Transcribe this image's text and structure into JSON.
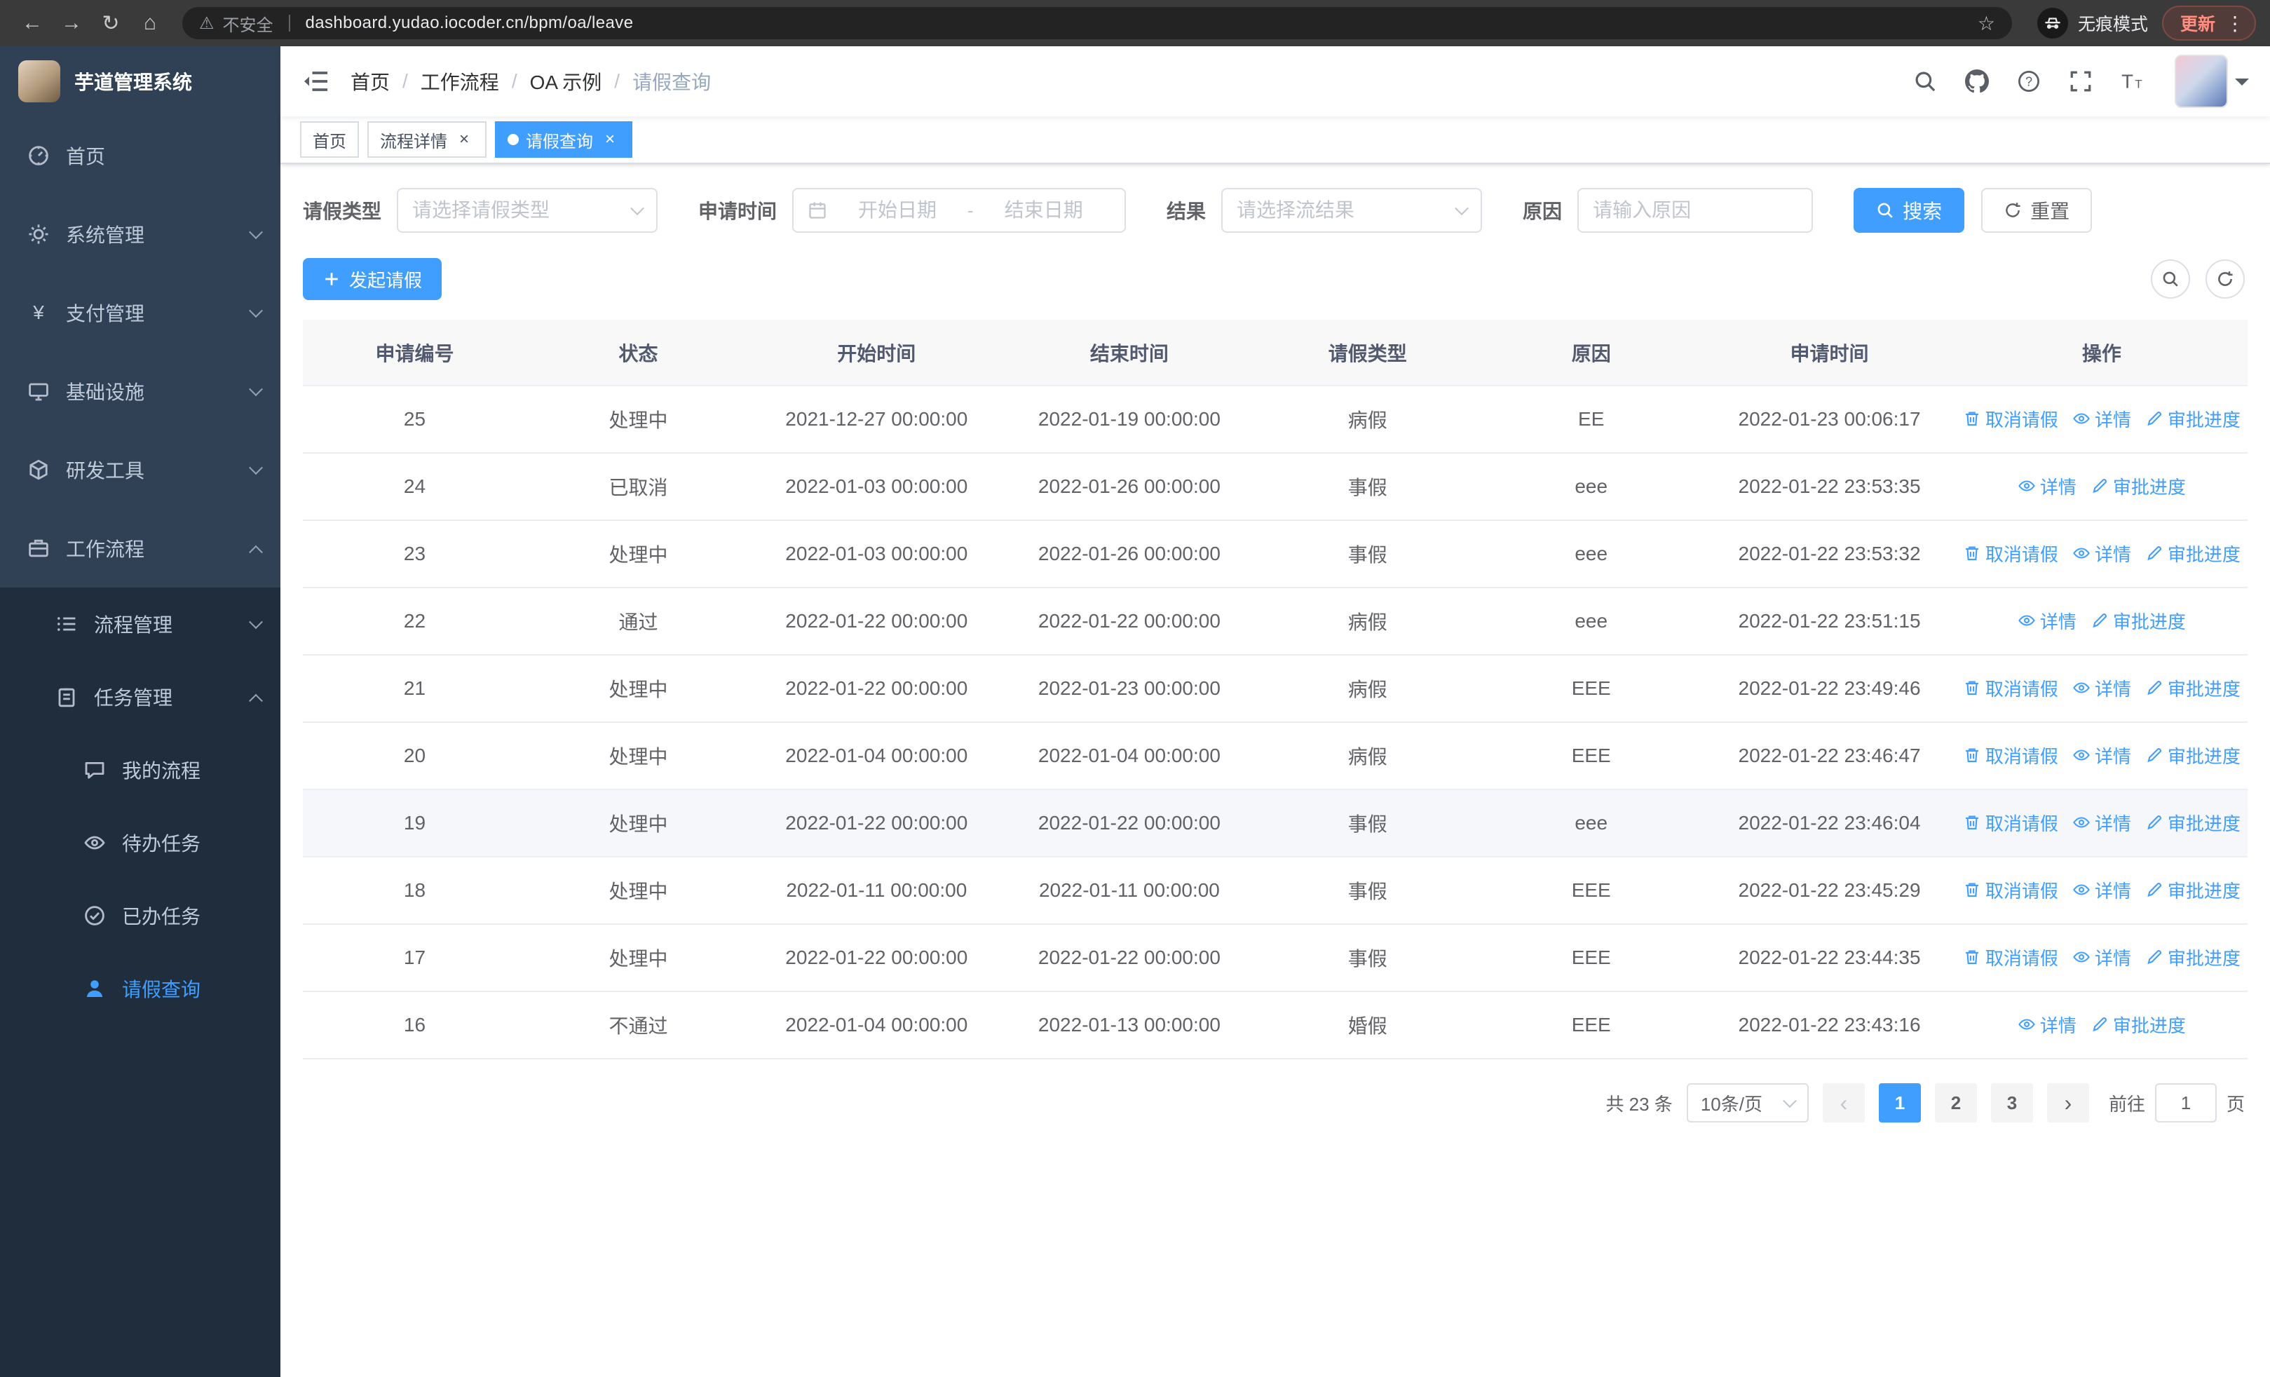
{
  "browser": {
    "security_label": "不安全",
    "url": "dashboard.yudao.iocoder.cn/bpm/oa/leave",
    "incognito_label": "无痕模式",
    "update_label": "更新"
  },
  "icons": {
    "back": "←",
    "forward": "→",
    "reload": "↻",
    "home": "⌂",
    "warning": "⚠",
    "star": "☆",
    "kebab": "⋮",
    "close": "×",
    "prev": "‹",
    "next": "›"
  },
  "app_title": "芋道管理系统",
  "sidebar": {
    "items": [
      {
        "label": "首页"
      },
      {
        "label": "系统管理"
      },
      {
        "label": "支付管理"
      },
      {
        "label": "基础设施"
      },
      {
        "label": "研发工具"
      },
      {
        "label": "工作流程"
      }
    ],
    "workflow_children": [
      {
        "label": "流程管理"
      },
      {
        "label": "任务管理"
      }
    ],
    "task_children": [
      {
        "label": "我的流程"
      },
      {
        "label": "待办任务"
      },
      {
        "label": "已办任务"
      },
      {
        "label": "请假查询"
      }
    ]
  },
  "breadcrumb": {
    "separator": "/",
    "items": [
      "首页",
      "工作流程",
      "OA 示例",
      "请假查询"
    ]
  },
  "tags": [
    {
      "label": "首页"
    },
    {
      "label": "流程详情"
    },
    {
      "label": "请假查询"
    }
  ],
  "filters": {
    "leave_type_label": "请假类型",
    "leave_type_placeholder": "请选择请假类型",
    "apply_time_label": "申请时间",
    "start_placeholder": "开始日期",
    "range_separator": "-",
    "end_placeholder": "结束日期",
    "result_label": "结果",
    "result_placeholder": "请选择流结果",
    "reason_label": "原因",
    "reason_placeholder": "请输入原因",
    "search_label": "搜索",
    "reset_label": "重置"
  },
  "toolbar": {
    "create_label": "发起请假"
  },
  "table": {
    "headers": [
      "申请编号",
      "状态",
      "开始时间",
      "结束时间",
      "请假类型",
      "原因",
      "申请时间",
      "操作"
    ],
    "action_labels": {
      "cancel": "取消请假",
      "detail": "详情",
      "progress": "审批进度"
    },
    "rows": [
      {
        "id": "25",
        "status": "处理中",
        "start_time": "2021-12-27 00:00:00",
        "end_time": "2022-01-19 00:00:00",
        "leave_type": "病假",
        "reason": "EE",
        "apply_time": "2022-01-23 00:06:17",
        "cancellable": true,
        "highlighted": false
      },
      {
        "id": "24",
        "status": "已取消",
        "start_time": "2022-01-03 00:00:00",
        "end_time": "2022-01-26 00:00:00",
        "leave_type": "事假",
        "reason": "eee",
        "apply_time": "2022-01-22 23:53:35",
        "cancellable": false,
        "highlighted": false
      },
      {
        "id": "23",
        "status": "处理中",
        "start_time": "2022-01-03 00:00:00",
        "end_time": "2022-01-26 00:00:00",
        "leave_type": "事假",
        "reason": "eee",
        "apply_time": "2022-01-22 23:53:32",
        "cancellable": true,
        "highlighted": false
      },
      {
        "id": "22",
        "status": "通过",
        "start_time": "2022-01-22 00:00:00",
        "end_time": "2022-01-22 00:00:00",
        "leave_type": "病假",
        "reason": "eee",
        "apply_time": "2022-01-22 23:51:15",
        "cancellable": false,
        "highlighted": false
      },
      {
        "id": "21",
        "status": "处理中",
        "start_time": "2022-01-22 00:00:00",
        "end_time": "2022-01-23 00:00:00",
        "leave_type": "病假",
        "reason": "EEE",
        "apply_time": "2022-01-22 23:49:46",
        "cancellable": true,
        "highlighted": false
      },
      {
        "id": "20",
        "status": "处理中",
        "start_time": "2022-01-04 00:00:00",
        "end_time": "2022-01-04 00:00:00",
        "leave_type": "病假",
        "reason": "EEE",
        "apply_time": "2022-01-22 23:46:47",
        "cancellable": true,
        "highlighted": false
      },
      {
        "id": "19",
        "status": "处理中",
        "start_time": "2022-01-22 00:00:00",
        "end_time": "2022-01-22 00:00:00",
        "leave_type": "事假",
        "reason": "eee",
        "apply_time": "2022-01-22 23:46:04",
        "cancellable": true,
        "highlighted": true
      },
      {
        "id": "18",
        "status": "处理中",
        "start_time": "2022-01-11 00:00:00",
        "end_time": "2022-01-11 00:00:00",
        "leave_type": "事假",
        "reason": "EEE",
        "apply_time": "2022-01-22 23:45:29",
        "cancellable": true,
        "highlighted": false
      },
      {
        "id": "17",
        "status": "处理中",
        "start_time": "2022-01-22 00:00:00",
        "end_time": "2022-01-22 00:00:00",
        "leave_type": "事假",
        "reason": "EEE",
        "apply_time": "2022-01-22 23:44:35",
        "cancellable": true,
        "highlighted": false
      },
      {
        "id": "16",
        "status": "不通过",
        "start_time": "2022-01-04 00:00:00",
        "end_time": "2022-01-13 00:00:00",
        "leave_type": "婚假",
        "reason": "EEE",
        "apply_time": "2022-01-22 23:43:16",
        "cancellable": false,
        "highlighted": false
      }
    ]
  },
  "pagination": {
    "total_label": "共 23 条",
    "page_size_label": "10条/页",
    "pages": [
      "1",
      "2",
      "3"
    ],
    "active_page": "1",
    "goto_label": "前往",
    "goto_value": "1",
    "unit_label": "页"
  },
  "colors": {
    "primary": "#409eff",
    "sidebar_bg": "#304156",
    "sidebar_sub_bg": "#1f2d3d"
  }
}
